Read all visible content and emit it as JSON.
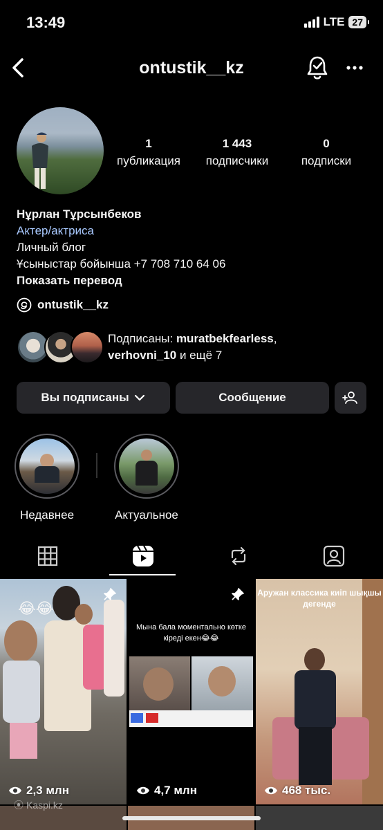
{
  "status": {
    "time": "13:49",
    "network": "LTE",
    "battery": "27"
  },
  "header": {
    "username": "ontustik__kz"
  },
  "profile": {
    "stats": [
      {
        "count": "1",
        "label": "публикация"
      },
      {
        "count": "1 443",
        "label": "подписчики"
      },
      {
        "count": "0",
        "label": "подписки"
      }
    ],
    "name": "Нұрлан Тұрсынбеков",
    "category": "Актер/актриса",
    "bio_line1": "Личный блог",
    "bio_line2": "Ұсыныстар бойынша +7 708 710 64 06",
    "translate": "Показать перевод",
    "threads_handle": "ontustik__kz",
    "followed_by_prefix": "Подписаны: ",
    "followed_by_user1": "muratbekfearless",
    "followed_by_comma": ",",
    "followed_by_user2": "verhovni_10",
    "followed_by_suffix": " и ещё 7"
  },
  "actions": {
    "following_label": "Вы подписаны",
    "message_label": "Сообщение"
  },
  "highlights": [
    {
      "label": "Недавнее"
    },
    {
      "label": "Актуальное"
    }
  ],
  "tabs": [
    {
      "icon": "grid-icon"
    },
    {
      "icon": "reels-icon"
    },
    {
      "icon": "reposts-icon"
    },
    {
      "icon": "tagged-icon"
    }
  ],
  "reels": [
    {
      "views": "2,3 млн",
      "caption": "",
      "pinned": true
    },
    {
      "views": "4,7 млн",
      "caption": "Мына бала моментально көтке кіреді екен😂😂",
      "pinned": true
    },
    {
      "views": "468 тыс.",
      "caption": "Аружан классика киіп шықшы дегенде",
      "pinned": false
    }
  ],
  "watermark": "Kaspi.kz",
  "colors": {
    "background": "#000000",
    "button": "#26262a",
    "link": "#a9c9ff",
    "text": "#f5f5f5"
  }
}
